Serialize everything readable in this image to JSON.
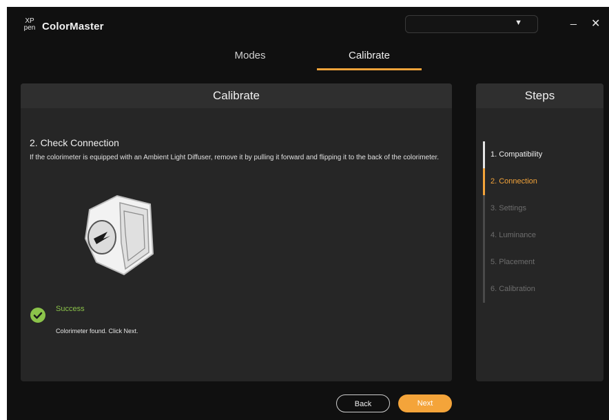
{
  "app": {
    "logo_text": "XP pen",
    "title": "ColorMaster",
    "device_select_value": "",
    "minimize_label": "_",
    "close_label": "✕"
  },
  "tabs": [
    {
      "label": "Modes",
      "active": false
    },
    {
      "label": "Calibrate",
      "active": true
    }
  ],
  "main": {
    "header": "Calibrate",
    "step_title": "2. Check Connection",
    "instruction": "If the colorimeter is equipped with an Ambient Light Diffuser, remove it by pulling it forward and flipping it to the back of the colorimeter.",
    "status": {
      "title": "Success",
      "message": "Colorimeter found. Click Next.",
      "icon": "check-circle-icon"
    }
  },
  "steps_panel": {
    "header": "Steps",
    "items": [
      {
        "label": "1. Compatibility",
        "state": "done"
      },
      {
        "label": "2. Connection",
        "state": "current"
      },
      {
        "label": "3. Settings",
        "state": "pending"
      },
      {
        "label": "4. Luminance",
        "state": "pending"
      },
      {
        "label": "5. Placement",
        "state": "pending"
      },
      {
        "label": "6. Calibration",
        "state": "pending"
      }
    ]
  },
  "footer": {
    "back_label": "Back",
    "next_label": "Next"
  },
  "colors": {
    "accent": "#f4a43a",
    "success": "#8bc34a",
    "background": "#101010",
    "panel": "#262626"
  }
}
